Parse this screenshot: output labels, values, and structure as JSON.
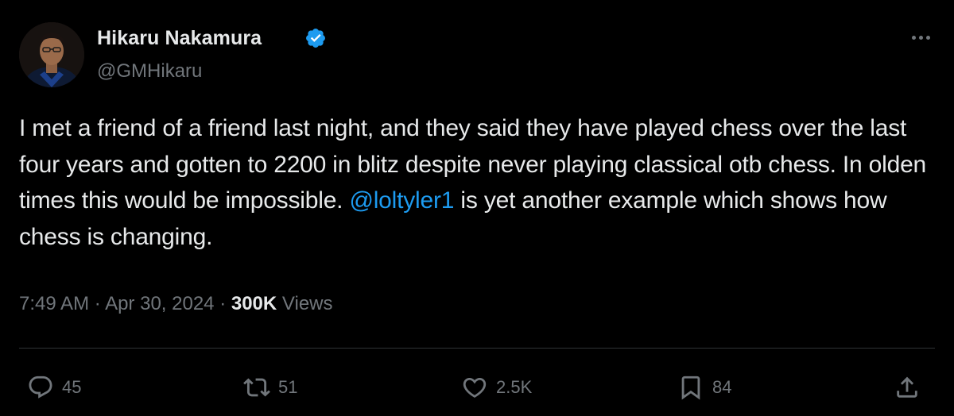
{
  "author": {
    "name": "Hikaru Nakamura",
    "handle": "@GMHikaru",
    "verified": true
  },
  "tweet": {
    "text_before_mention": "I met a friend of a friend last night, and they said they have played chess over the last four years and gotten to 2200 in blitz despite never playing classical otb chess. In olden times this would be impossible. ",
    "mention": "@loltyler1",
    "text_after_mention": " is yet another example which shows how chess is changing."
  },
  "meta": {
    "time": "7:49 AM",
    "separator": "·",
    "date": "Apr 30, 2024",
    "views_count": "300K",
    "views_label": "Views"
  },
  "actions": {
    "replies": "45",
    "reposts": "51",
    "likes": "2.5K",
    "bookmarks": "84"
  },
  "colors": {
    "background": "#000000",
    "text": "#e7e9ea",
    "secondary": "#71767b",
    "accent": "#1d9bf0",
    "divider": "#2f3336"
  },
  "icons": [
    "more-icon",
    "verified-icon",
    "reply-icon",
    "repost-icon",
    "like-icon",
    "bookmark-icon",
    "share-icon"
  ]
}
